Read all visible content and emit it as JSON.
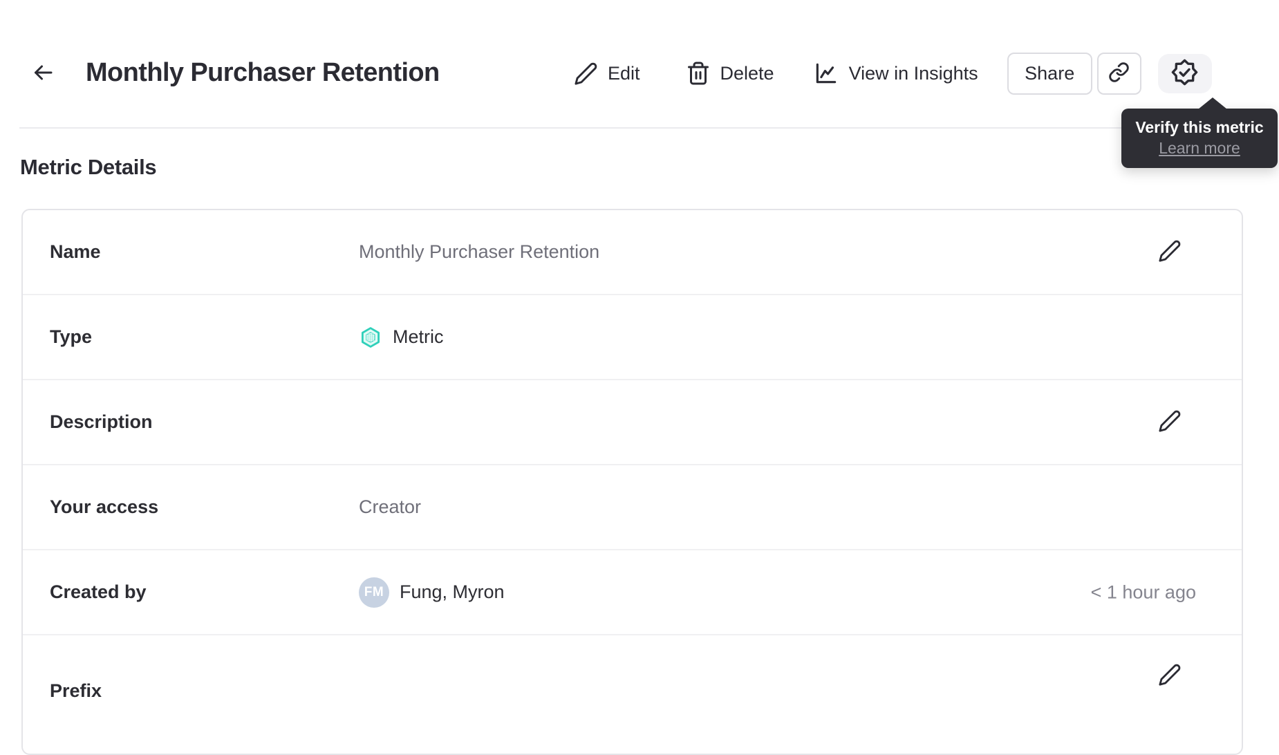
{
  "header": {
    "title": "Monthly Purchaser Retention",
    "actions": {
      "edit": "Edit",
      "delete": "Delete",
      "insights": "View in Insights",
      "share": "Share"
    }
  },
  "tooltip": {
    "title": "Verify this metric",
    "link": "Learn more"
  },
  "section": {
    "heading": "Metric Details"
  },
  "details": {
    "rows": [
      {
        "label": "Name",
        "value": "Monthly Purchaser Retention",
        "editable": true
      },
      {
        "label": "Type",
        "value": "Metric",
        "icon": "metric-hexagon-icon"
      },
      {
        "label": "Description",
        "value": "",
        "editable": true
      },
      {
        "label": "Your access",
        "value": "Creator"
      },
      {
        "label": "Created by",
        "value": "Fung, Myron",
        "avatar_initials": "FM",
        "meta": "< 1 hour ago"
      },
      {
        "label": "Prefix",
        "value": "",
        "editable": true
      }
    ]
  },
  "colors": {
    "accent_teal": "#2fd0ba",
    "accent_teal_fill": "#e3fbf6",
    "tooltip_bg": "#2e2e34",
    "avatar_bg": "#c7d2e2",
    "text_dark": "#2d2d33",
    "text_gray": "#6f6f79"
  }
}
